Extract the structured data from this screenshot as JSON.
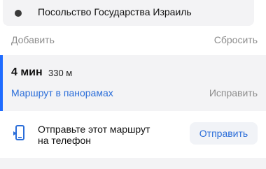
{
  "destination": {
    "text": "Посольство Государства Израиль",
    "icon": "location-dot-icon"
  },
  "actions": {
    "add_label": "Добавить",
    "reset_label": "Сбросить"
  },
  "route": {
    "time": "4 мин",
    "distance": "330 м",
    "panorama_link": "Маршрут в панорамах",
    "fix_label": "Исправить",
    "accent_color": "#1e6bff"
  },
  "send": {
    "icon": "phone-icon",
    "text_line1": "Отправьте этот маршрут",
    "text_line2": "на телефон",
    "button_label": "Отправить"
  },
  "colors": {
    "link_blue": "#2a6dd9",
    "muted_gray": "#8d8d8d",
    "panel_bg": "#f3f3f5"
  }
}
